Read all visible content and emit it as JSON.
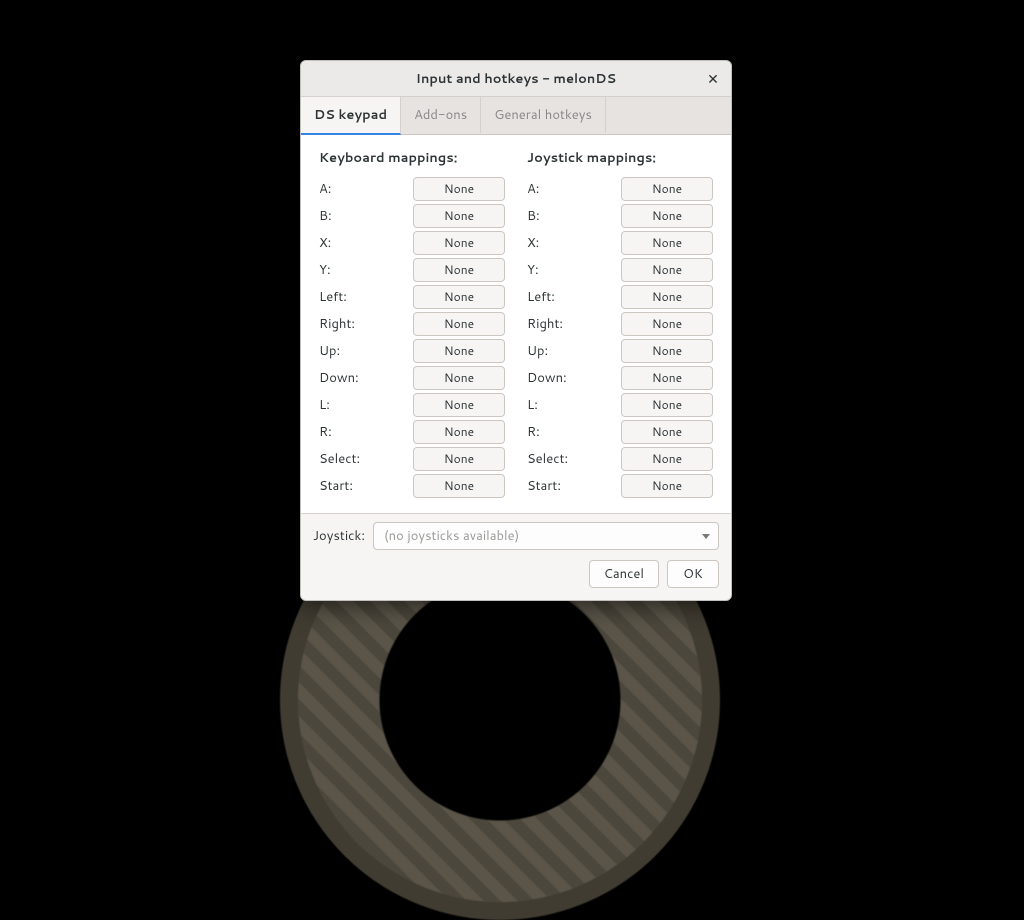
{
  "window": {
    "title": "Input and hotkeys - melonDS"
  },
  "tabs": [
    {
      "label": "DS keypad",
      "active": true
    },
    {
      "label": "Add-ons",
      "active": false
    },
    {
      "label": "General hotkeys",
      "active": false
    }
  ],
  "columns": {
    "left": {
      "heading": "Keyboard mappings:"
    },
    "right": {
      "heading": "Joystick mappings:"
    }
  },
  "keys": [
    {
      "label": "A:",
      "kb": "None",
      "joy": "None"
    },
    {
      "label": "B:",
      "kb": "None",
      "joy": "None"
    },
    {
      "label": "X:",
      "kb": "None",
      "joy": "None"
    },
    {
      "label": "Y:",
      "kb": "None",
      "joy": "None"
    },
    {
      "label": "Left:",
      "kb": "None",
      "joy": "None"
    },
    {
      "label": "Right:",
      "kb": "None",
      "joy": "None"
    },
    {
      "label": "Up:",
      "kb": "None",
      "joy": "None"
    },
    {
      "label": "Down:",
      "kb": "None",
      "joy": "None"
    },
    {
      "label": "L:",
      "kb": "None",
      "joy": "None"
    },
    {
      "label": "R:",
      "kb": "None",
      "joy": "None"
    },
    {
      "label": "Select:",
      "kb": "None",
      "joy": "None"
    },
    {
      "label": "Start:",
      "kb": "None",
      "joy": "None"
    }
  ],
  "joystick": {
    "label": "Joystick:",
    "selected": "(no joysticks available)"
  },
  "buttons": {
    "cancel": "Cancel",
    "ok": "OK"
  }
}
